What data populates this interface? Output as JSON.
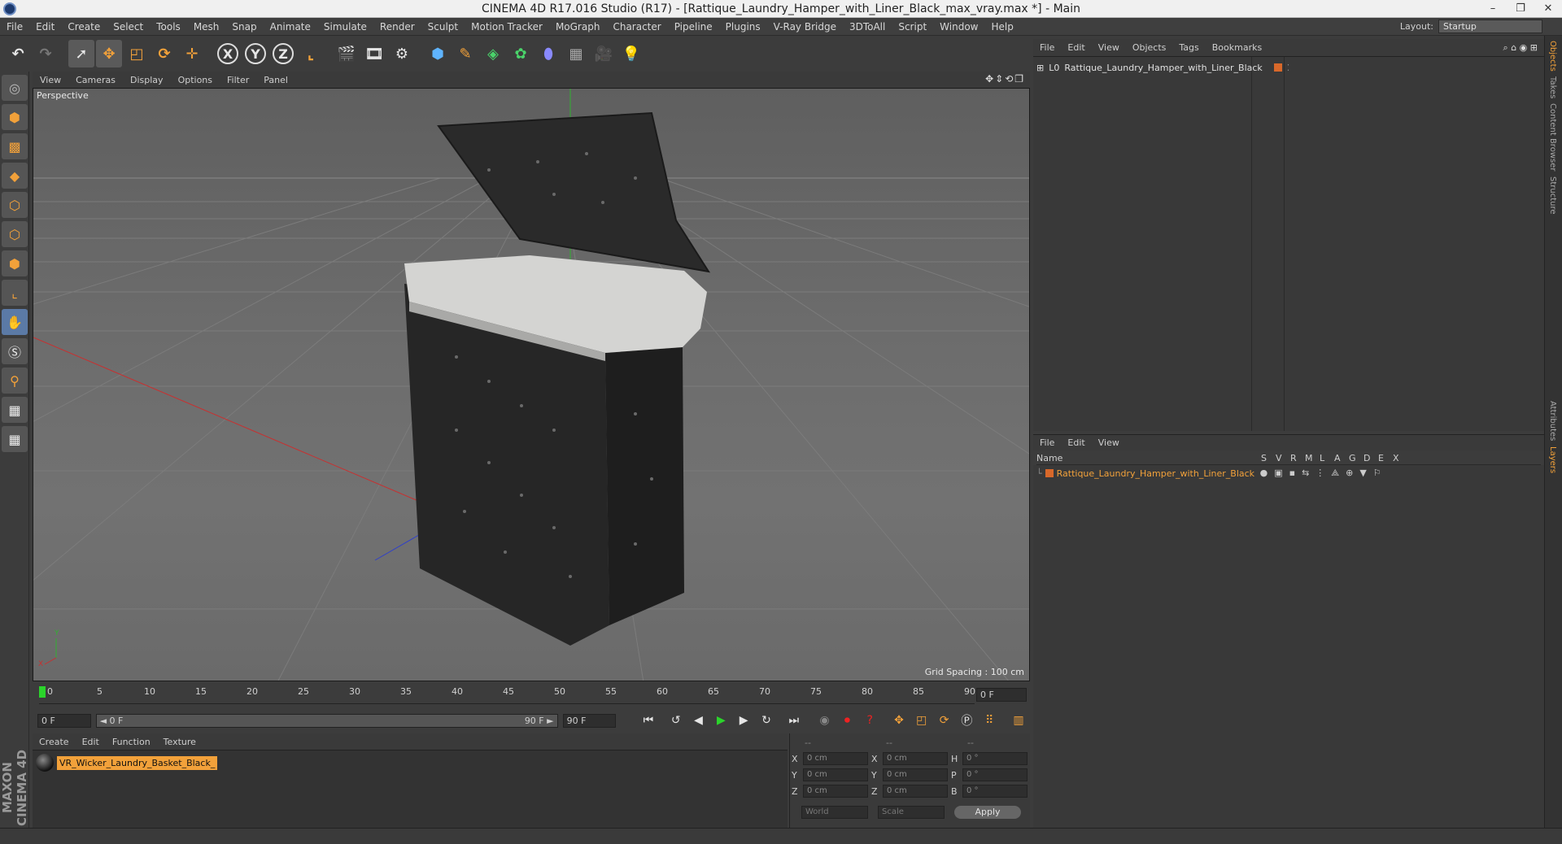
{
  "window": {
    "title": "CINEMA 4D R17.016 Studio (R17) - [Rattique_Laundry_Hamper_with_Liner_Black_max_vray.max *] - Main"
  },
  "menubar": {
    "items": [
      "File",
      "Edit",
      "Create",
      "Select",
      "Tools",
      "Mesh",
      "Snap",
      "Animate",
      "Simulate",
      "Render",
      "Sculpt",
      "Motion Tracker",
      "MoGraph",
      "Character",
      "Pipeline",
      "Plugins",
      "V-Ray Bridge",
      "3DToAll",
      "Script",
      "Window",
      "Help"
    ],
    "layout_label": "Layout:",
    "layout_value": "Startup"
  },
  "viewport": {
    "menu": [
      "View",
      "Cameras",
      "Display",
      "Options",
      "Filter",
      "Panel"
    ],
    "label": "Perspective",
    "grid_spacing": "Grid Spacing : 100 cm"
  },
  "timeline": {
    "ticks": [
      "0",
      "5",
      "10",
      "15",
      "20",
      "25",
      "30",
      "35",
      "40",
      "45",
      "50",
      "55",
      "60",
      "65",
      "70",
      "75",
      "80",
      "85",
      "90"
    ],
    "current_frame": "0 F",
    "start_field": "0 F",
    "range_start": "◄ 0 F",
    "range_end": "90 F ►",
    "end_field": "90 F"
  },
  "material_manager": {
    "menu": [
      "Create",
      "Edit",
      "Function",
      "Texture"
    ],
    "materials": [
      "VR_Wicker_Laundry_Basket_Black_"
    ]
  },
  "coordinates": {
    "headers": [
      "--",
      "--",
      "--"
    ],
    "rows": [
      {
        "a": "X",
        "av": "0 cm",
        "b": "X",
        "bv": "0 cm",
        "c": "H",
        "cv": "0 °"
      },
      {
        "a": "Y",
        "av": "0 cm",
        "b": "Y",
        "bv": "0 cm",
        "c": "P",
        "cv": "0 °"
      },
      {
        "a": "Z",
        "av": "0 cm",
        "b": "Z",
        "bv": "0 cm",
        "c": "B",
        "cv": "0 °"
      }
    ],
    "world": "World",
    "scale": "Scale",
    "apply": "Apply"
  },
  "object_manager": {
    "menu": [
      "File",
      "Edit",
      "View",
      "Objects",
      "Tags",
      "Bookmarks"
    ],
    "objects": [
      "Rattique_Laundry_Hamper_with_Liner_Black"
    ]
  },
  "layer_manager": {
    "menu": [
      "File",
      "Edit",
      "View"
    ],
    "columns": [
      "Name",
      "S",
      "V",
      "R",
      "M",
      "L",
      "A",
      "G",
      "D",
      "E",
      "X"
    ],
    "layers": [
      "Rattique_Laundry_Hamper_with_Liner_Black"
    ]
  },
  "right_tabs": [
    "Objects",
    "Takes",
    "Content Browser",
    "Structure",
    "Attributes",
    "Layers"
  ],
  "brand": "MAXON CINEMA 4D",
  "colors": {
    "accent": "#f2a13a",
    "layer": "#d8682a",
    "axis_x": "#c83030",
    "axis_y": "#30b030",
    "axis_z": "#3040c8"
  }
}
